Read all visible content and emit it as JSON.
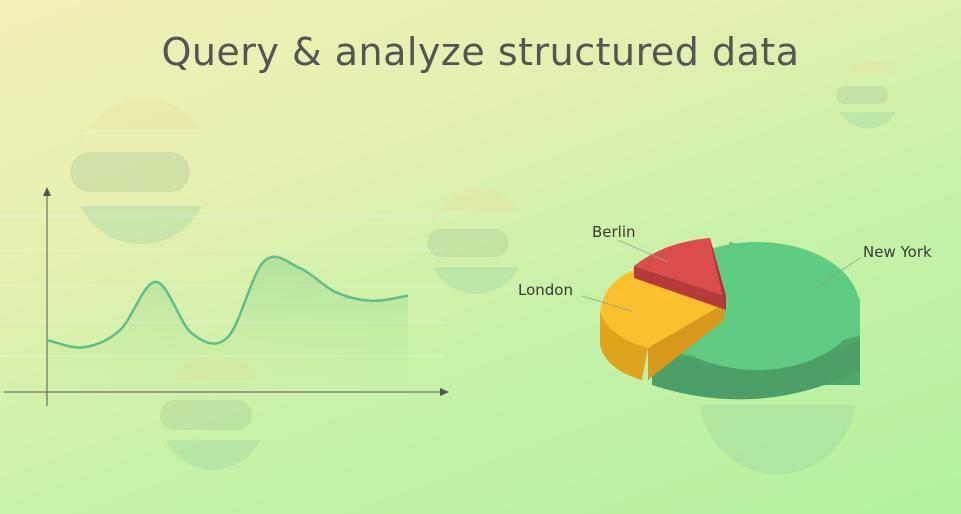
{
  "title": "Query & analyze structured data",
  "colors": {
    "line": "#5fbf8a",
    "area": "#9fdc9a",
    "new_york": "#5fcc82",
    "london": "#fbc02d",
    "berlin": "#dc4c4c"
  },
  "decorative_logos": [
    "elastic-logo",
    "elastic-logo",
    "elastic-logo",
    "elastic-logo",
    "elastic-logo"
  ],
  "chart_data": [
    {
      "type": "area",
      "title": "",
      "xlabel": "",
      "ylabel": "",
      "grid": true,
      "x": [
        0,
        1,
        2,
        3,
        4,
        5,
        6,
        7,
        8,
        9,
        10
      ],
      "series": [
        {
          "values": [
            3.0,
            2.6,
            3.6,
            6.4,
            3.4,
            3.2,
            7.6,
            7.2,
            5.8,
            5.3,
            5.6
          ]
        }
      ],
      "ylim": [
        0,
        10
      ]
    },
    {
      "type": "pie",
      "labels": [
        "New York",
        "London",
        "Berlin"
      ],
      "values": [
        64,
        21,
        15
      ],
      "exploded": [
        "London",
        "Berlin"
      ],
      "style": "3d"
    }
  ]
}
